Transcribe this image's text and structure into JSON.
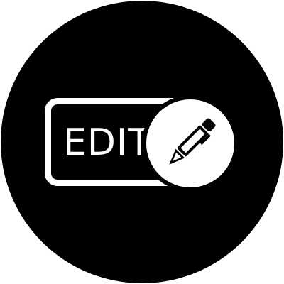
{
  "badge": {
    "label": "EDIT",
    "icon": "pen-icon",
    "colors": {
      "background": "#000000",
      "foreground": "#ffffff"
    }
  }
}
